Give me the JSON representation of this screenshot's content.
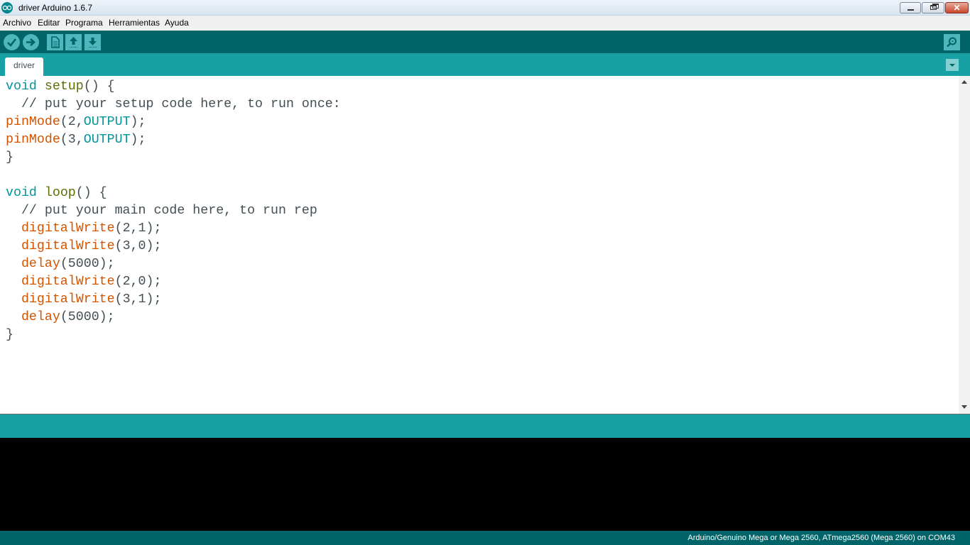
{
  "window": {
    "title": "driver Arduino 1.6.7",
    "close_label": "✕"
  },
  "menu": {
    "items": [
      "Archivo",
      "Editar",
      "Programa",
      "Herramientas",
      "Ayuda"
    ]
  },
  "toolbar": {
    "buttons": [
      "verify-icon",
      "upload-icon",
      "new-icon",
      "open-icon",
      "save-icon",
      "serial-monitor-icon"
    ]
  },
  "tabs": [
    {
      "label": "driver"
    }
  ],
  "editor": {
    "lines": [
      "void setup() {",
      "  // put your setup code here, to run once:",
      "pinMode(2,OUTPUT);",
      "pinMode(3,OUTPUT);",
      "}",
      "",
      "void loop() {",
      "  // put your main code here, to run rep",
      "  digitalWrite(2,1);",
      "  digitalWrite(3,0);",
      "  delay(5000);",
      "  digitalWrite(2,0);",
      "  digitalWrite(3,1);",
      "  delay(5000);",
      "}"
    ]
  },
  "footer": {
    "board_info": "Arduino/Genuino Mega or Mega 2560, ATmega2560 (Mega 2560) on COM43"
  },
  "colors": {
    "toolbar": "#006468",
    "tabstrip": "#17a1a5",
    "keyword": "#00979c",
    "function": "#5e6d03",
    "arduino_fn": "#d35400",
    "text": "#434f54"
  }
}
